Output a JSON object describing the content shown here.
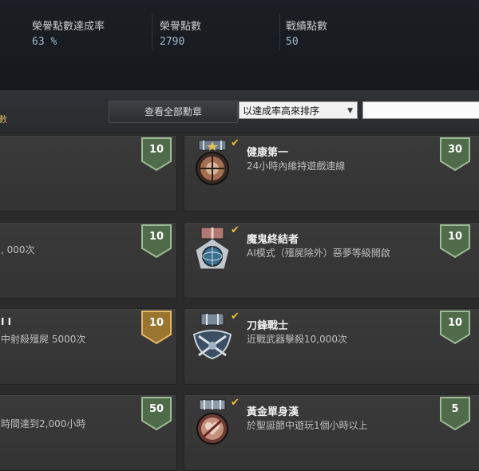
{
  "stats": {
    "completion_label": "榮譽點數達成率",
    "completion_value": "63 %",
    "honor_label": "榮譽點數",
    "honor_value": "2790",
    "battle_label": "戰績點數",
    "battle_value": "50"
  },
  "toolbar": {
    "left_partial": "數",
    "view_all_label": "查看全部勳章",
    "sort_selected": "以達成率高來排序",
    "search_value": ""
  },
  "left_column": [
    {
      "points": "10",
      "desc": "",
      "title": ""
    },
    {
      "points": "10",
      "desc": ", 000次",
      "title": ""
    },
    {
      "points": "10",
      "desc": "中射殺殭屍 5000次",
      "title": "I I"
    },
    {
      "points": "50",
      "desc": "時間達到2,000小時",
      "title": ""
    }
  ],
  "right_column": [
    {
      "title": "健康第一",
      "desc": "24小時內維持遊戲連線",
      "points": "30",
      "icon": "medal-star-icon"
    },
    {
      "title": "魔鬼終結者",
      "desc": "AI模式（殭屍除外）惡夢等級開啟",
      "points": "10",
      "icon": "medal-globe-icon"
    },
    {
      "title": "刀鋒戰士",
      "desc": "近戰武器擊殺10,000次",
      "points": "10",
      "icon": "medal-crossed-blades-icon"
    },
    {
      "title": "黃金單身漢",
      "desc": "於聖誕節中遊玩1個小時以上",
      "points": "5",
      "icon": "medal-no-heart-icon"
    }
  ],
  "colors": {
    "shield_green": "#4f6b4a",
    "shield_gold": "#9a7530",
    "check_gold": "#e8c237",
    "stat_value_blue": "#9fb8cf"
  }
}
